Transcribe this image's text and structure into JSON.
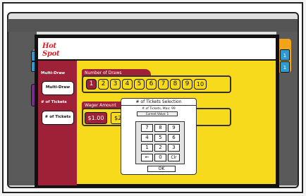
{
  "header": {
    "logo": "Hot Spot"
  },
  "left_panel": {
    "multidraw": {
      "title": "Multi-Draw",
      "button": "Multi-Draw"
    },
    "tickets": {
      "title": "# of Tickets",
      "button": "# of Tickets"
    }
  },
  "draws": {
    "title": "Number of Draws",
    "options": [
      "1",
      "2",
      "3",
      "4",
      "5",
      "6",
      "7",
      "8",
      "9",
      "10"
    ],
    "selected": "1"
  },
  "wager": {
    "title": "Wager Amount",
    "options": [
      "$1.00",
      "$2."
    ],
    "selected": "$1.00"
  },
  "right_nubs": [
    "1",
    "1"
  ],
  "modal": {
    "title": "# of Tickets Selection",
    "subtitle": "# of Tickets, Max: 99",
    "current_value": "Current Value: 1",
    "keys": [
      "7",
      "8",
      "9",
      "4",
      "5",
      "6",
      "1",
      "2",
      "3",
      "←",
      "0",
      "Clr"
    ],
    "ok": "OK"
  },
  "colors": {
    "primary_yellow": "#f7da1c",
    "maroon": "#9e2137",
    "accent_orange": "#f2a319",
    "accent_blue": "#2d9bd3"
  }
}
